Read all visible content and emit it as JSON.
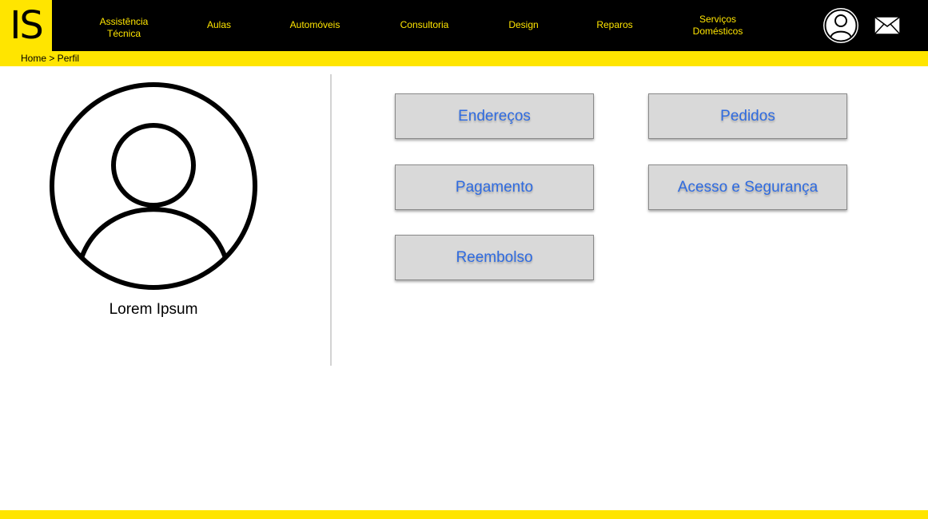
{
  "header": {
    "logo_text": "IS",
    "nav": [
      "Assistência\nTécnica",
      "Aulas",
      "Automóveis",
      "Consultoria",
      "Design",
      "Reparos",
      "Serviços\nDomésticos"
    ],
    "icons": [
      "user-icon",
      "mail-icon"
    ],
    "colors": {
      "bar": "#000000",
      "accent": "#ffe500"
    }
  },
  "breadcrumb": "Home > Perfil",
  "profile": {
    "avatar_icon": "user-avatar-icon",
    "name": "Lorem Ipsum"
  },
  "menu": [
    "Endereços",
    "Pedidos",
    "Pagamento",
    "Acesso e Segurança",
    "Reembolso"
  ],
  "colors": {
    "card_text": "#2f6be0",
    "card_bg": "#d9d9d9"
  }
}
